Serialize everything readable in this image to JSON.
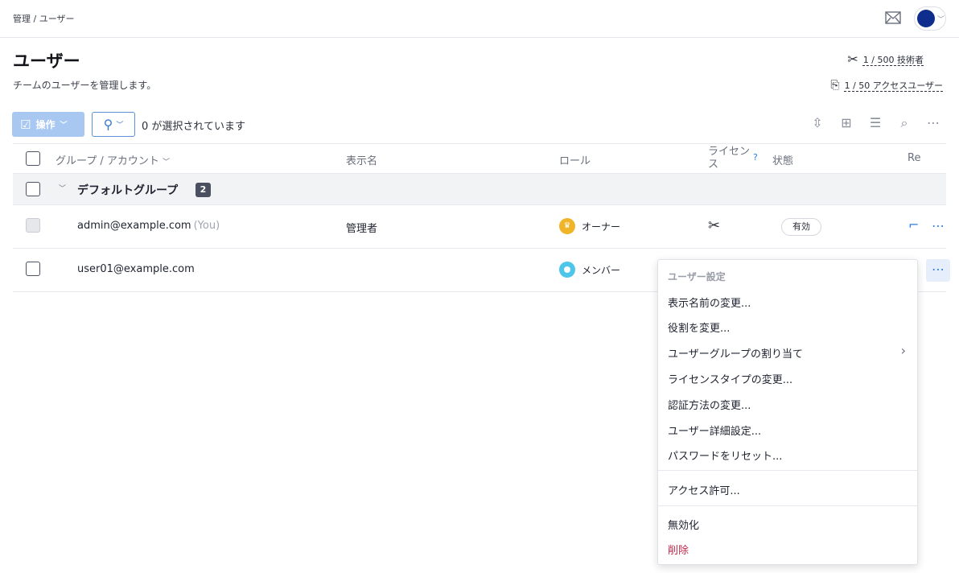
{
  "breadcrumb": "管理 / ユーザー",
  "page": {
    "title": "ユーザー",
    "subtitle": "チームのユーザーを管理します。"
  },
  "stats": {
    "technician": "1 / 500 技術者",
    "access": "1 / 50 アクセスユーザー"
  },
  "toolbar": {
    "operations_label": "操作",
    "selected_text": "0 が選択されています"
  },
  "table": {
    "headers": {
      "group_account": "グループ / アカウント",
      "display_name": "表示名",
      "role": "ロール",
      "license": "ライセンス",
      "status": "状態",
      "remote": "Re"
    },
    "group": {
      "name": "デフォルトグループ",
      "count": "2"
    },
    "rows": [
      {
        "email": "admin@example.com",
        "you": "(You)",
        "display_name": "管理者",
        "role": "オーナー",
        "status": "有効"
      },
      {
        "email": "user01@example.com",
        "you": "",
        "display_name": "",
        "role": "メンバー",
        "status": ""
      }
    ]
  },
  "menu": {
    "header": "ユーザー設定",
    "items": [
      "表示名前の変更...",
      "役割を変更...",
      "ユーザーグループの割り当て",
      "ライセンスタイプの変更...",
      "認証方法の変更...",
      "ユーザー詳細設定...",
      "パスワードをリセット...",
      "アクセス許可...",
      "無効化",
      "削除"
    ]
  },
  "colors": {
    "accent": "#2f7de1",
    "danger": "#c0294b",
    "owner": "#f0b429",
    "member": "#4ec6ea"
  }
}
